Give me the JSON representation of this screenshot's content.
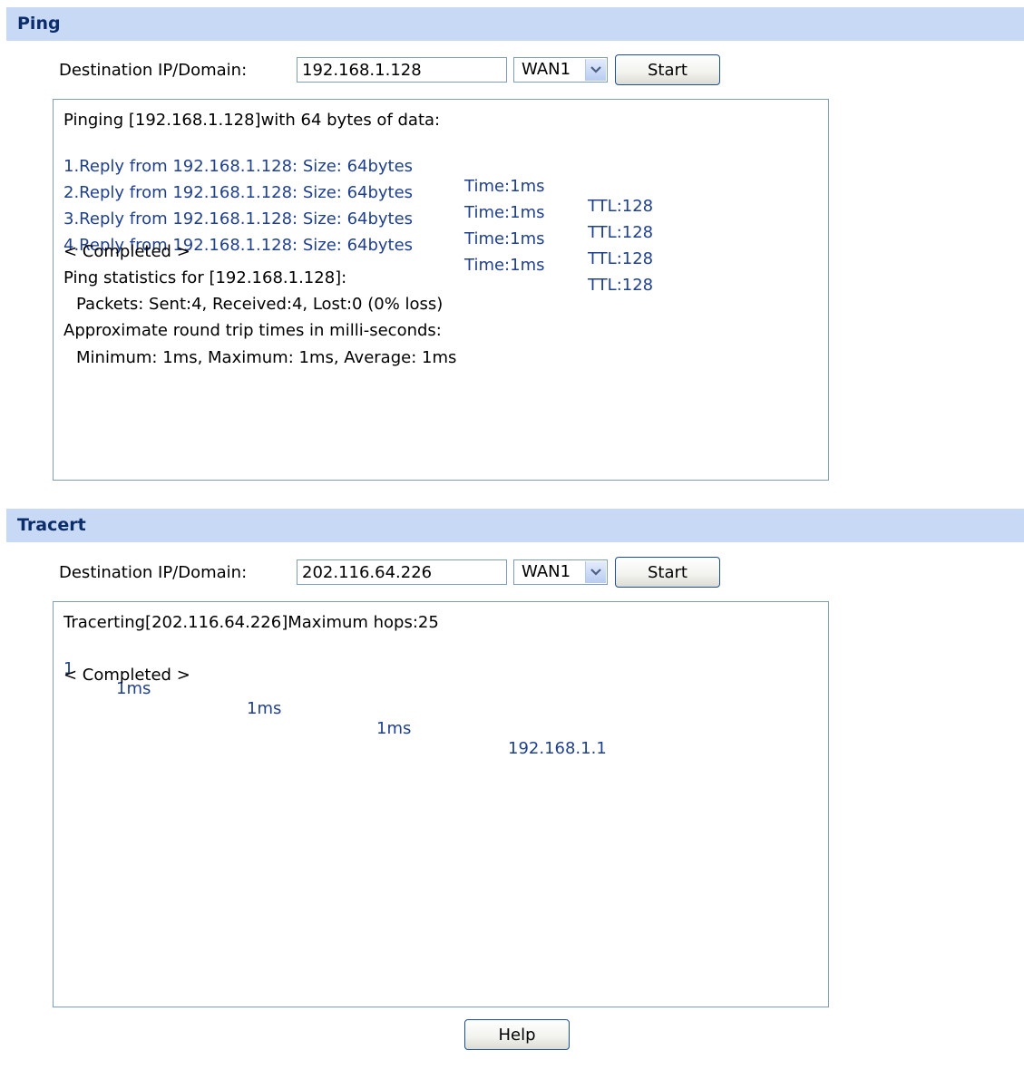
{
  "ping": {
    "title": "Ping",
    "label": "Destination IP/Domain:",
    "ip_value": "192.168.1.128",
    "wan_value": "WAN1",
    "start_label": "Start",
    "header_line": "Pinging [192.168.1.128]with 64 bytes of data:",
    "replies": [
      {
        "from": "1.Reply from 192.168.1.128: Size: 64bytes",
        "time": "Time:1ms",
        "ttl": "TTL:128"
      },
      {
        "from": "2.Reply from 192.168.1.128: Size: 64bytes",
        "time": "Time:1ms",
        "ttl": "TTL:128"
      },
      {
        "from": "3.Reply from 192.168.1.128: Size: 64bytes",
        "time": "Time:1ms",
        "ttl": "TTL:128"
      },
      {
        "from": "4.Reply from 192.168.1.128: Size: 64bytes",
        "time": "Time:1ms",
        "ttl": "TTL:128"
      }
    ],
    "completed": "< Completed >",
    "stats_header": "Ping statistics for [192.168.1.128]:",
    "packets": "Packets: Sent:4, Received:4, Lost:0 (0% loss)",
    "rtt_header": "Approximate round trip times in milli-seconds:",
    "rtt_values": "Minimum: 1ms, Maximum: 1ms, Average: 1ms"
  },
  "tracert": {
    "title": "Tracert",
    "label": "Destination IP/Domain:",
    "ip_value": "202.116.64.226",
    "wan_value": "WAN1",
    "start_label": "Start",
    "header_line": "Tracerting[202.116.64.226]Maximum hops:25",
    "hops": [
      {
        "hop": "1",
        "t1": "1ms",
        "t2": "1ms",
        "t3": "1ms",
        "address": "192.168.1.1"
      }
    ],
    "completed": "< Completed >"
  },
  "help_label": "Help",
  "colors": {
    "section_bar": "#c7d9f5",
    "section_title": "#0c2d6b",
    "reply_text": "#1f3f8f",
    "border": "#7f9db9"
  }
}
